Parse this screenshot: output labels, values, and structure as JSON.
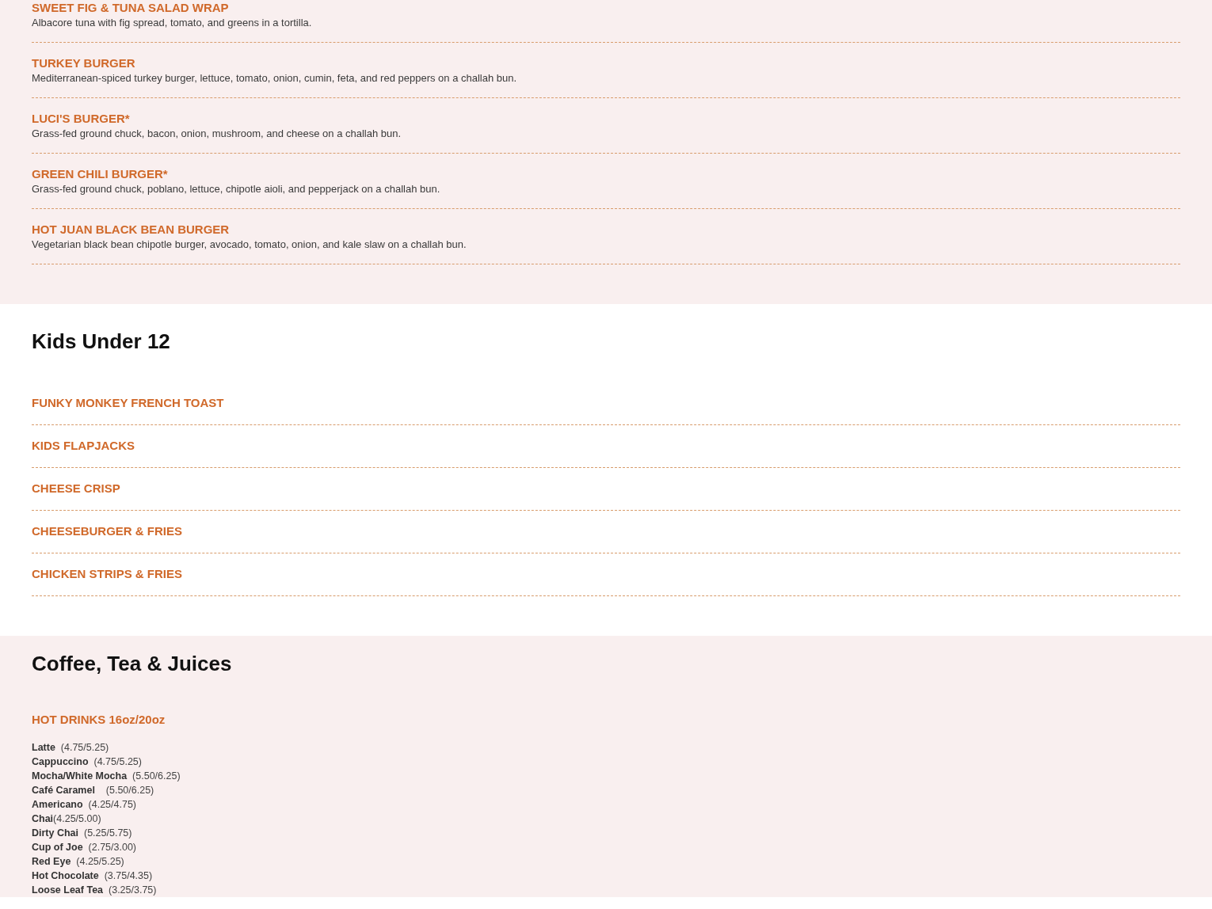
{
  "sections": [
    {
      "kind": "described",
      "items": [
        {
          "name": "SWEET FIG & TUNA SALAD WRAP",
          "description": "Albacore tuna with fig spread, tomato, and greens in a tortilla."
        },
        {
          "name": "TURKEY BURGER",
          "description": "Mediterranean-spiced turkey burger, lettuce, tomato, onion, cumin, feta, and red peppers on a challah bun."
        },
        {
          "name": "LUCI'S BURGER*",
          "description": "Grass-fed ground chuck, bacon, onion, mushroom, and cheese on a challah bun."
        },
        {
          "name": "GREEN CHILI BURGER*",
          "description": "Grass-fed ground chuck, poblano, lettuce, chipotle aioli, and pepperjack on a challah bun."
        },
        {
          "name": "HOT JUAN BLACK BEAN BURGER",
          "description": "Vegetarian black bean chipotle burger, avocado, tomato, onion, and  kale slaw on a challah bun."
        }
      ]
    },
    {
      "kind": "plain",
      "heading": "Kids Under 12",
      "items": [
        {
          "name": "FUNKY MONKEY FRENCH TOAST"
        },
        {
          "name": "KIDS FLAPJACKS"
        },
        {
          "name": "CHEESE CRISP"
        },
        {
          "name": "CHEESEBURGER & FRIES"
        },
        {
          "name": "CHICKEN STRIPS & FRIES"
        }
      ]
    },
    {
      "kind": "drinks",
      "heading": "Coffee, Tea & Juices",
      "subheading": "HOT DRINKS 16oz/20oz",
      "lines": [
        "**Latte**  (4.75/5.25)",
        "**Cappuccino**  (4.75/5.25)",
        "**Mocha/White Mocha**  (5.50/6.25)",
        "**Café Caramel**    (5.50/6.25)",
        "**Americano**  (4.25/4.75)",
        "**Chai**(4.25/5.00)",
        "**Dirty Chai**  (5.25/5.75)",
        "**Cup of Joe**  (2.75/3.00)",
        "**Red Eye**  (4.25/5.25)",
        "**Hot Chocolate**  (3.75/4.35)",
        "**Loose Leaf Tea**  (3.25/3.75)"
      ]
    }
  ]
}
